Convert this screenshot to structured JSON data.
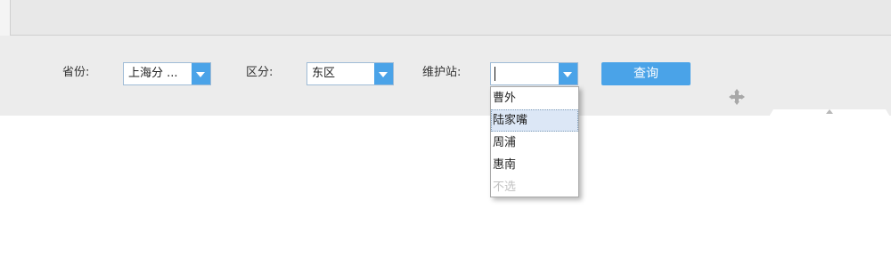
{
  "filters": {
    "province": {
      "label": "省份:",
      "value": "上海分 ..."
    },
    "district": {
      "label": "区分:",
      "value": "东区"
    },
    "station": {
      "label": "维护站:",
      "value": ""
    }
  },
  "query_button": "查询",
  "dropdown": {
    "options": [
      "曹外",
      "陆家嘴",
      "周浦",
      "惠南",
      "不选"
    ],
    "highlighted_index": 1
  },
  "colors": {
    "accent": "#4aa3e8",
    "panel": "#ececec",
    "highlight": "#dce7f6"
  },
  "icons": [
    "tab-icon",
    "chevron-down-icon",
    "move-icon",
    "collapse-arrow-icon"
  ]
}
